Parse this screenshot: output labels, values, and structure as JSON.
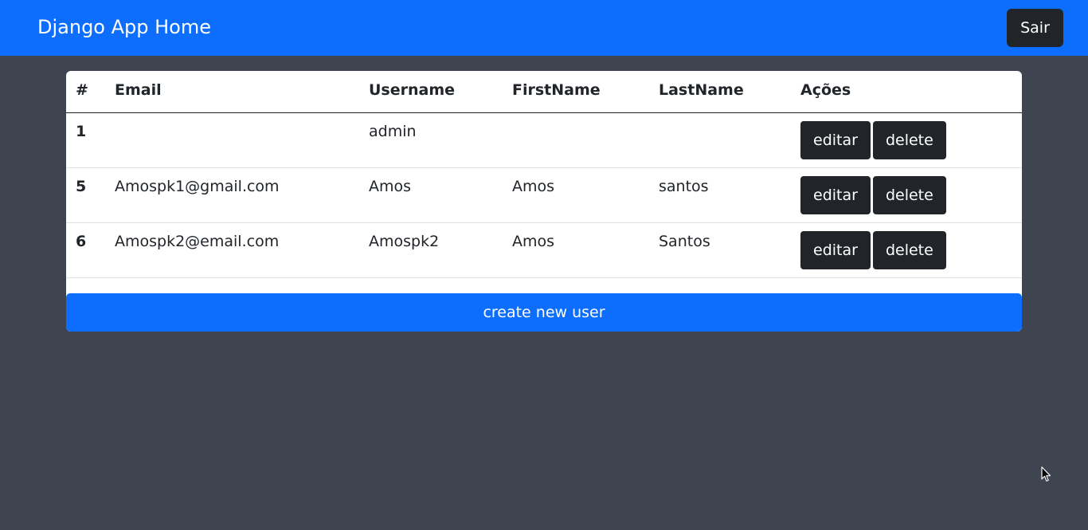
{
  "navbar": {
    "brand": "Django App Home",
    "logout_label": "Sair",
    "background": "#0d6efd"
  },
  "table": {
    "headers": [
      "#",
      "Email",
      "Username",
      "FirstName",
      "LastName",
      "Ações"
    ],
    "rows": [
      {
        "id": "1",
        "email": "",
        "username": "admin",
        "first_name": "",
        "last_name": ""
      },
      {
        "id": "5",
        "email": "Amospk1@gmail.com",
        "username": "Amos",
        "first_name": "Amos",
        "last_name": "santos"
      },
      {
        "id": "6",
        "email": "Amospk2@email.com",
        "username": "Amospk2",
        "first_name": "Amos",
        "last_name": "Santos"
      }
    ],
    "edit_label": "editar",
    "delete_label": "delete"
  },
  "create_label": "create new user",
  "colors": {
    "page_background": "#3f4550",
    "dark_button": "#212529",
    "primary": "#0d6efd"
  }
}
